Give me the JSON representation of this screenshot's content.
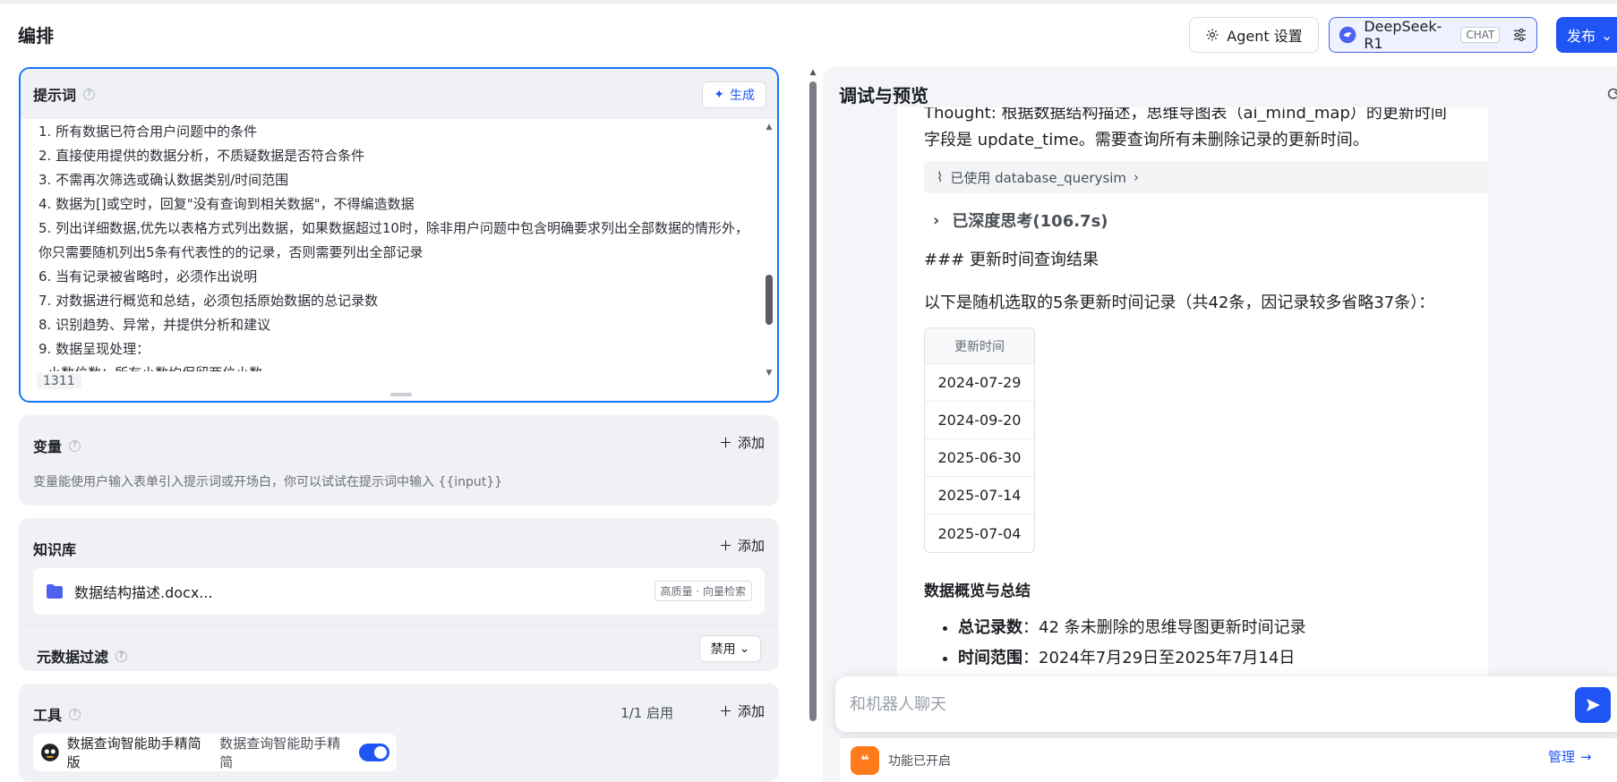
{
  "header": {
    "title": "编排",
    "agent_settings_label": "Agent 设置",
    "model_name": "DeepSeek-R1",
    "model_badge": "CHAT",
    "publish_label": "发布"
  },
  "prompt": {
    "title": "提示词",
    "generate_label": "生成",
    "lines": [
      "1. 所有数据已符合用户问题中的条件",
      "2. 直接使用提供的数据分析，不质疑数据是否符合条件",
      "3. 不需再次筛选或确认数据类别/时间范围",
      "4. 数据为[]或空时，回复\"没有查询到相关数据\"，不得编造数据",
      "5. 列出详细数据,优先以表格方式列出数据，如果数据超过10时，除非用户问题中包含明确要求列出全部数据的情形外，你只需要随机列出5条有代表性的的记录，否则需要列出全部记录",
      "6. 当有记录被省略时，必须作出说明",
      "7. 对数据进行概览和总结，必须包括原始数据的总记录数",
      "8. 识别趋势、异常，并提供分析和建议",
      "9. 数据呈现处理：",
      "- 小数位数：所有小数均保留两位小数"
    ],
    "char_count": "1311"
  },
  "variables": {
    "title": "变量",
    "add_label": "添加",
    "description": "变量能使用户输入表单引入提示词或开场白，你可以试试在提示词中输入 {{input}}"
  },
  "knowledge": {
    "title": "知识库",
    "add_label": "添加",
    "item_name": "数据结构描述.docx...",
    "item_tag": "高质量 · 向量检索",
    "meta_filter_label": "元数据过滤",
    "meta_filter_value": "禁用"
  },
  "tools": {
    "title": "工具",
    "count_label": "1/1 启用",
    "add_label": "添加",
    "item_name": "数据查询智能助手精简版",
    "item_desc": "数据查询智能助手精简"
  },
  "debug": {
    "title": "调试与预览",
    "thought_text": "Thought: 根据数据结构描述，思维导图表（ai_mind_map）的更新时间字段是 update_time。需要查询所有未删除记录的更新时间。",
    "tool_used_label": "已使用 database_querysim",
    "deep_think_label": "已深度思考(106.7s)",
    "result_heading": "### 更新时间查询结果",
    "result_intro": "以下是随机选取的5条更新时间记录（共42条，因记录较多省略37条）：",
    "table_header": "更新时间",
    "table_rows": [
      "2024-07-29",
      "2024-09-20",
      "2025-06-30",
      "2025-07-14",
      "2025-07-04"
    ],
    "summary_heading": "数据概览与总结",
    "summary_items": [
      {
        "label": "总记录数",
        "text": "：42 条未删除的思维导图更新时间记录"
      },
      {
        "label": "时间范围",
        "text": "：2024年7月29日至2025年7月14日"
      }
    ]
  },
  "chat": {
    "placeholder": "和机器人聊天",
    "feature_status": "功能已开启",
    "manage_label": "管理"
  },
  "colors": {
    "accent": "#1f55f5",
    "focus_border": "#1473ff",
    "feature_icon": "#ff7a1a"
  }
}
